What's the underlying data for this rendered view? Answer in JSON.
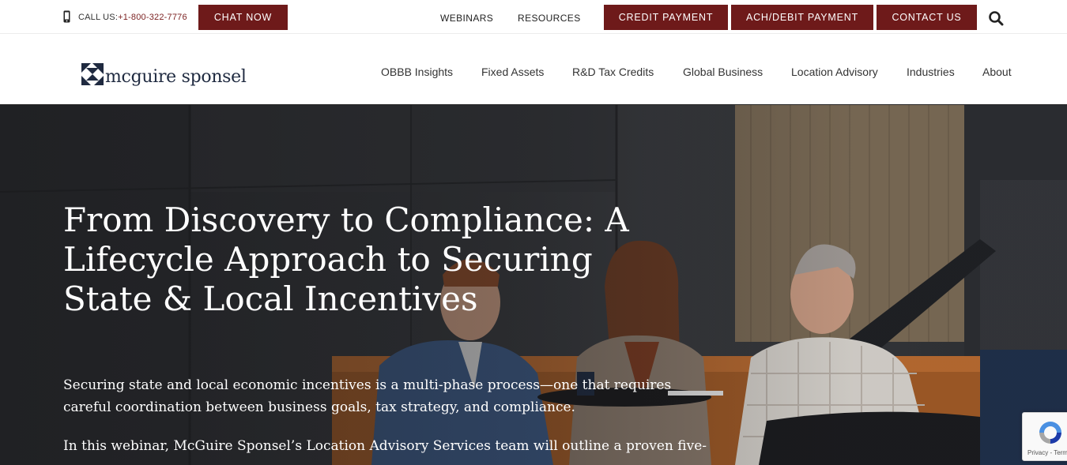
{
  "utility_bar": {
    "call_label": "CALL US:",
    "phone_number": "+1-800-322-7776",
    "chat_label": "CHAT NOW",
    "links": [
      "WEBINARS",
      "RESOURCES"
    ],
    "credit_label": "CREDIT PAYMENT",
    "ach_label": "ACH/DEBIT PAYMENT",
    "contact_label": "CONTACT US",
    "icons": [
      "phone-icon",
      "search-icon"
    ]
  },
  "brand": {
    "name": "mcguire sponsel",
    "logo_color": "#1f2a40",
    "accent": "#6e1a1a"
  },
  "nav": {
    "items": [
      "OBBB Insights",
      "Fixed Assets",
      "R&D Tax Credits",
      "Global Business",
      "Location Advisory",
      "Industries",
      "About"
    ]
  },
  "hero": {
    "title": "From Discovery to Compliance: A Lifecycle Approach to Securing State & Local Incentives",
    "paragraph1": "Securing state and local economic incentives is a multi-phase process—one that requires careful coordination between business goals, tax strategy, and compliance.",
    "paragraph2": "In this webinar, McGuire Sponsel’s Location Advisory Services team will outline a proven five-"
  },
  "recaptcha": {
    "text": "Privacy - Terms"
  }
}
